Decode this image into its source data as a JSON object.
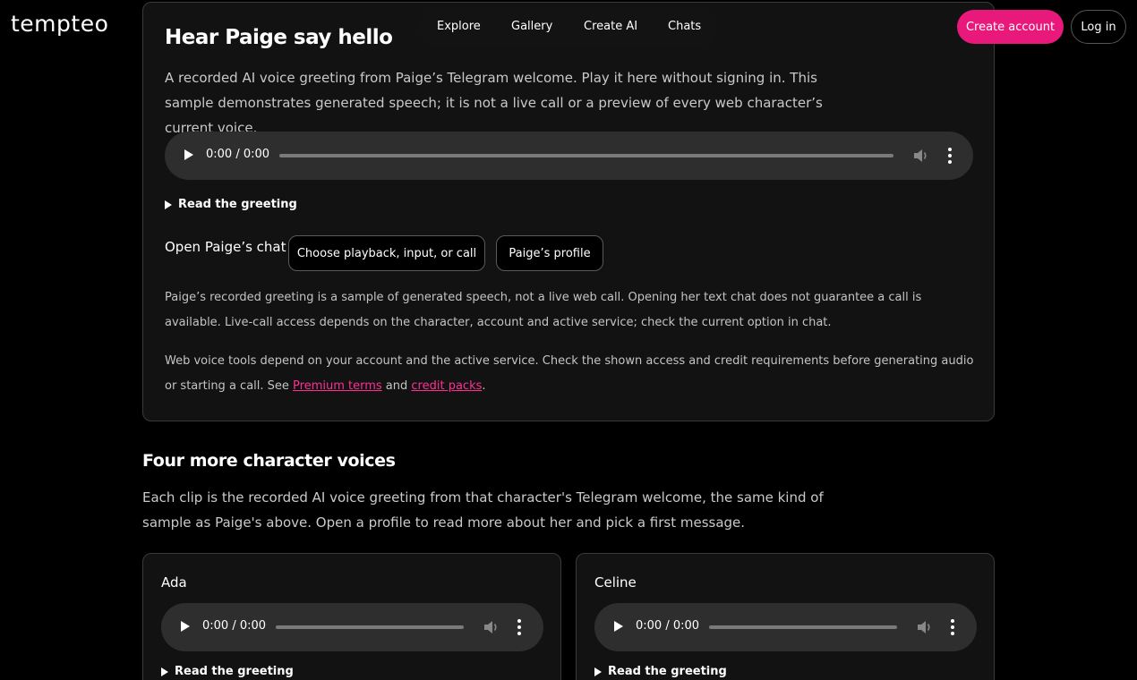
{
  "brand": {
    "logo": "tempteo"
  },
  "nav": {
    "items": [
      "Explore",
      "Gallery",
      "Create AI",
      "Chats"
    ]
  },
  "header": {
    "create_account": "Create account",
    "log_in": "Log in"
  },
  "colors": {
    "accent": "#e8197a",
    "link": "#ff2f92",
    "background": "#000000",
    "card": "#121212"
  },
  "main": {
    "title": "Hear Paige say hello",
    "intro": "A recorded AI voice greeting from Paige’s Telegram welcome. Play it here without signing in. This sample demonstrates generated speech; it is not a live call or a preview of every web character’s current voice.",
    "audio": {
      "time": "0:00 / 0:00",
      "play_icon": "play-icon",
      "volume_icon": "volume-icon",
      "menu_icon": "more-vertical-icon"
    },
    "read_greeting": "Read the greeting",
    "open_chat_label": "Open Paige’s chat",
    "choose_button": "Choose playback, input, or call",
    "profile_button": "Paige’s profile",
    "note1": "Paige’s recorded greeting is a sample of generated speech, not a live web call. Opening her text chat does not guarantee a call is available. Live-call access depends on the character, account and active service; check the current option in chat.",
    "note2_text": "Web voice tools depend on your account and the active service. Check the shown access and credit requirements before generating audio or starting a call. See ",
    "premium_terms": "Premium terms",
    "and_text": " and ",
    "credit_packs": "credit packs",
    "period": "."
  },
  "more": {
    "title": "Four more character voices",
    "desc": "Each clip is the recorded AI voice greeting from that character's Telegram welcome, the same kind of sample as Paige's above. Open a profile to read more about her and pick a first message.",
    "cards": [
      {
        "name": "Ada",
        "time": "0:00 / 0:00",
        "read": "Read the greeting"
      },
      {
        "name": "Celine",
        "time": "0:00 / 0:00",
        "read": "Read the greeting"
      }
    ]
  }
}
